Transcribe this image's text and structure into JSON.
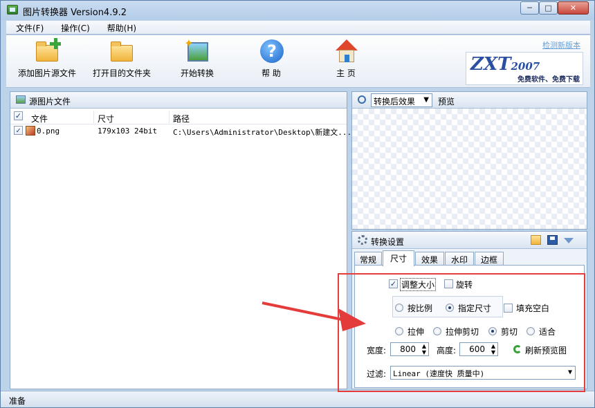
{
  "window": {
    "title": "图片转换器 Version4.9.2",
    "controls": {
      "minimize": "─",
      "maximize": "□",
      "close": "✕"
    }
  },
  "menu": [
    "文件(F)",
    "操作(C)",
    "帮助(H)"
  ],
  "toolbar": {
    "add_source": "添加图片源文件",
    "open_folder": "打开目的文件夹",
    "start_convert": "开始转换",
    "help": "帮 助",
    "home": "主 页"
  },
  "brand": {
    "link": "检测新版本",
    "logo": "ZXT",
    "logo_year": "2007",
    "slogan": "免费软件、免费下载"
  },
  "source_panel": {
    "title": "源图片文件",
    "columns": [
      "文件",
      "尺寸",
      "路径"
    ],
    "rows": [
      {
        "checked": true,
        "file": "0.png",
        "size": "179x103  24bit",
        "path": "C:\\Users\\Administrator\\Desktop\\新建文..."
      }
    ]
  },
  "preview": {
    "mode": "转换后效果",
    "label": "预览"
  },
  "settings": {
    "title": "转换设置",
    "tabs": [
      "常规",
      "尺寸",
      "效果",
      "水印",
      "边框"
    ],
    "active_tab": "尺寸",
    "resize": {
      "label": "调整大小",
      "checked": true
    },
    "rotate": {
      "label": "旋转",
      "checked": false
    },
    "by_ratio": "按比例",
    "fixed_size": "指定尺寸",
    "fill_blank": "填充空白",
    "mode": {
      "stretch": "拉伸",
      "stretch_crop": "拉伸剪切",
      "crop": "剪切",
      "fit": "适合",
      "selected": "剪切"
    },
    "width_label": "宽度:",
    "width_value": "800",
    "height_label": "高度:",
    "height_value": "600",
    "refresh": "刷新预览图",
    "filter_label": "过滤:",
    "filter_value": "Linear (速度快 质量中)"
  },
  "status": "准备",
  "annotation": {
    "box_color": "#e43b3b",
    "arrow_color": "#e43b3b"
  }
}
